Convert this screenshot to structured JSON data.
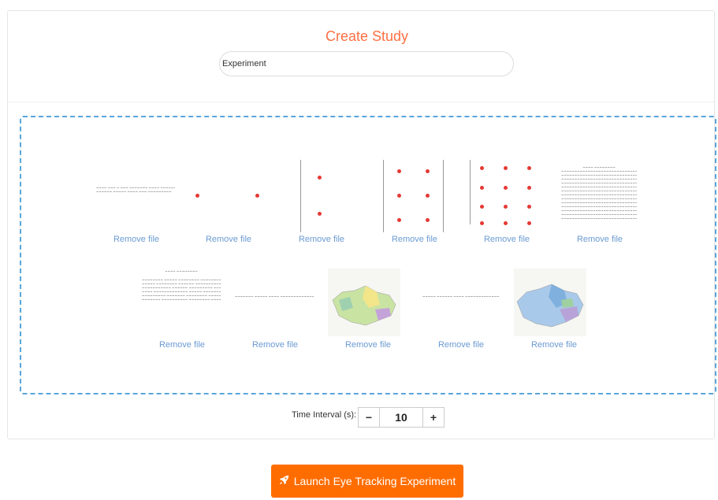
{
  "header": {
    "title": "Create Study"
  },
  "study_name": {
    "value": "Experiment"
  },
  "files_row1": [
    {
      "remove_label": "Remove file"
    },
    {
      "remove_label": "Remove file"
    },
    {
      "remove_label": "Remove file"
    },
    {
      "remove_label": "Remove file"
    },
    {
      "remove_label": "Remove file"
    },
    {
      "remove_label": "Remove file"
    }
  ],
  "files_row2": [
    {
      "remove_label": "Remove file"
    },
    {
      "remove_label": "Remove file"
    },
    {
      "remove_label": "Remove file"
    },
    {
      "remove_label": "Remove file"
    },
    {
      "remove_label": "Remove file"
    }
  ],
  "time_interval": {
    "label": "Time Interval (s):",
    "value": "10",
    "minus": "−",
    "plus": "+"
  },
  "launch": {
    "label": "Launch Eye Tracking Experiment",
    "icon": "rocket-icon"
  },
  "colors": {
    "accent": "#ff6d00",
    "title": "#ff7043",
    "link": "#6b9bd2",
    "dropzone_border": "#5aa5dc",
    "dot": "#e53935"
  }
}
